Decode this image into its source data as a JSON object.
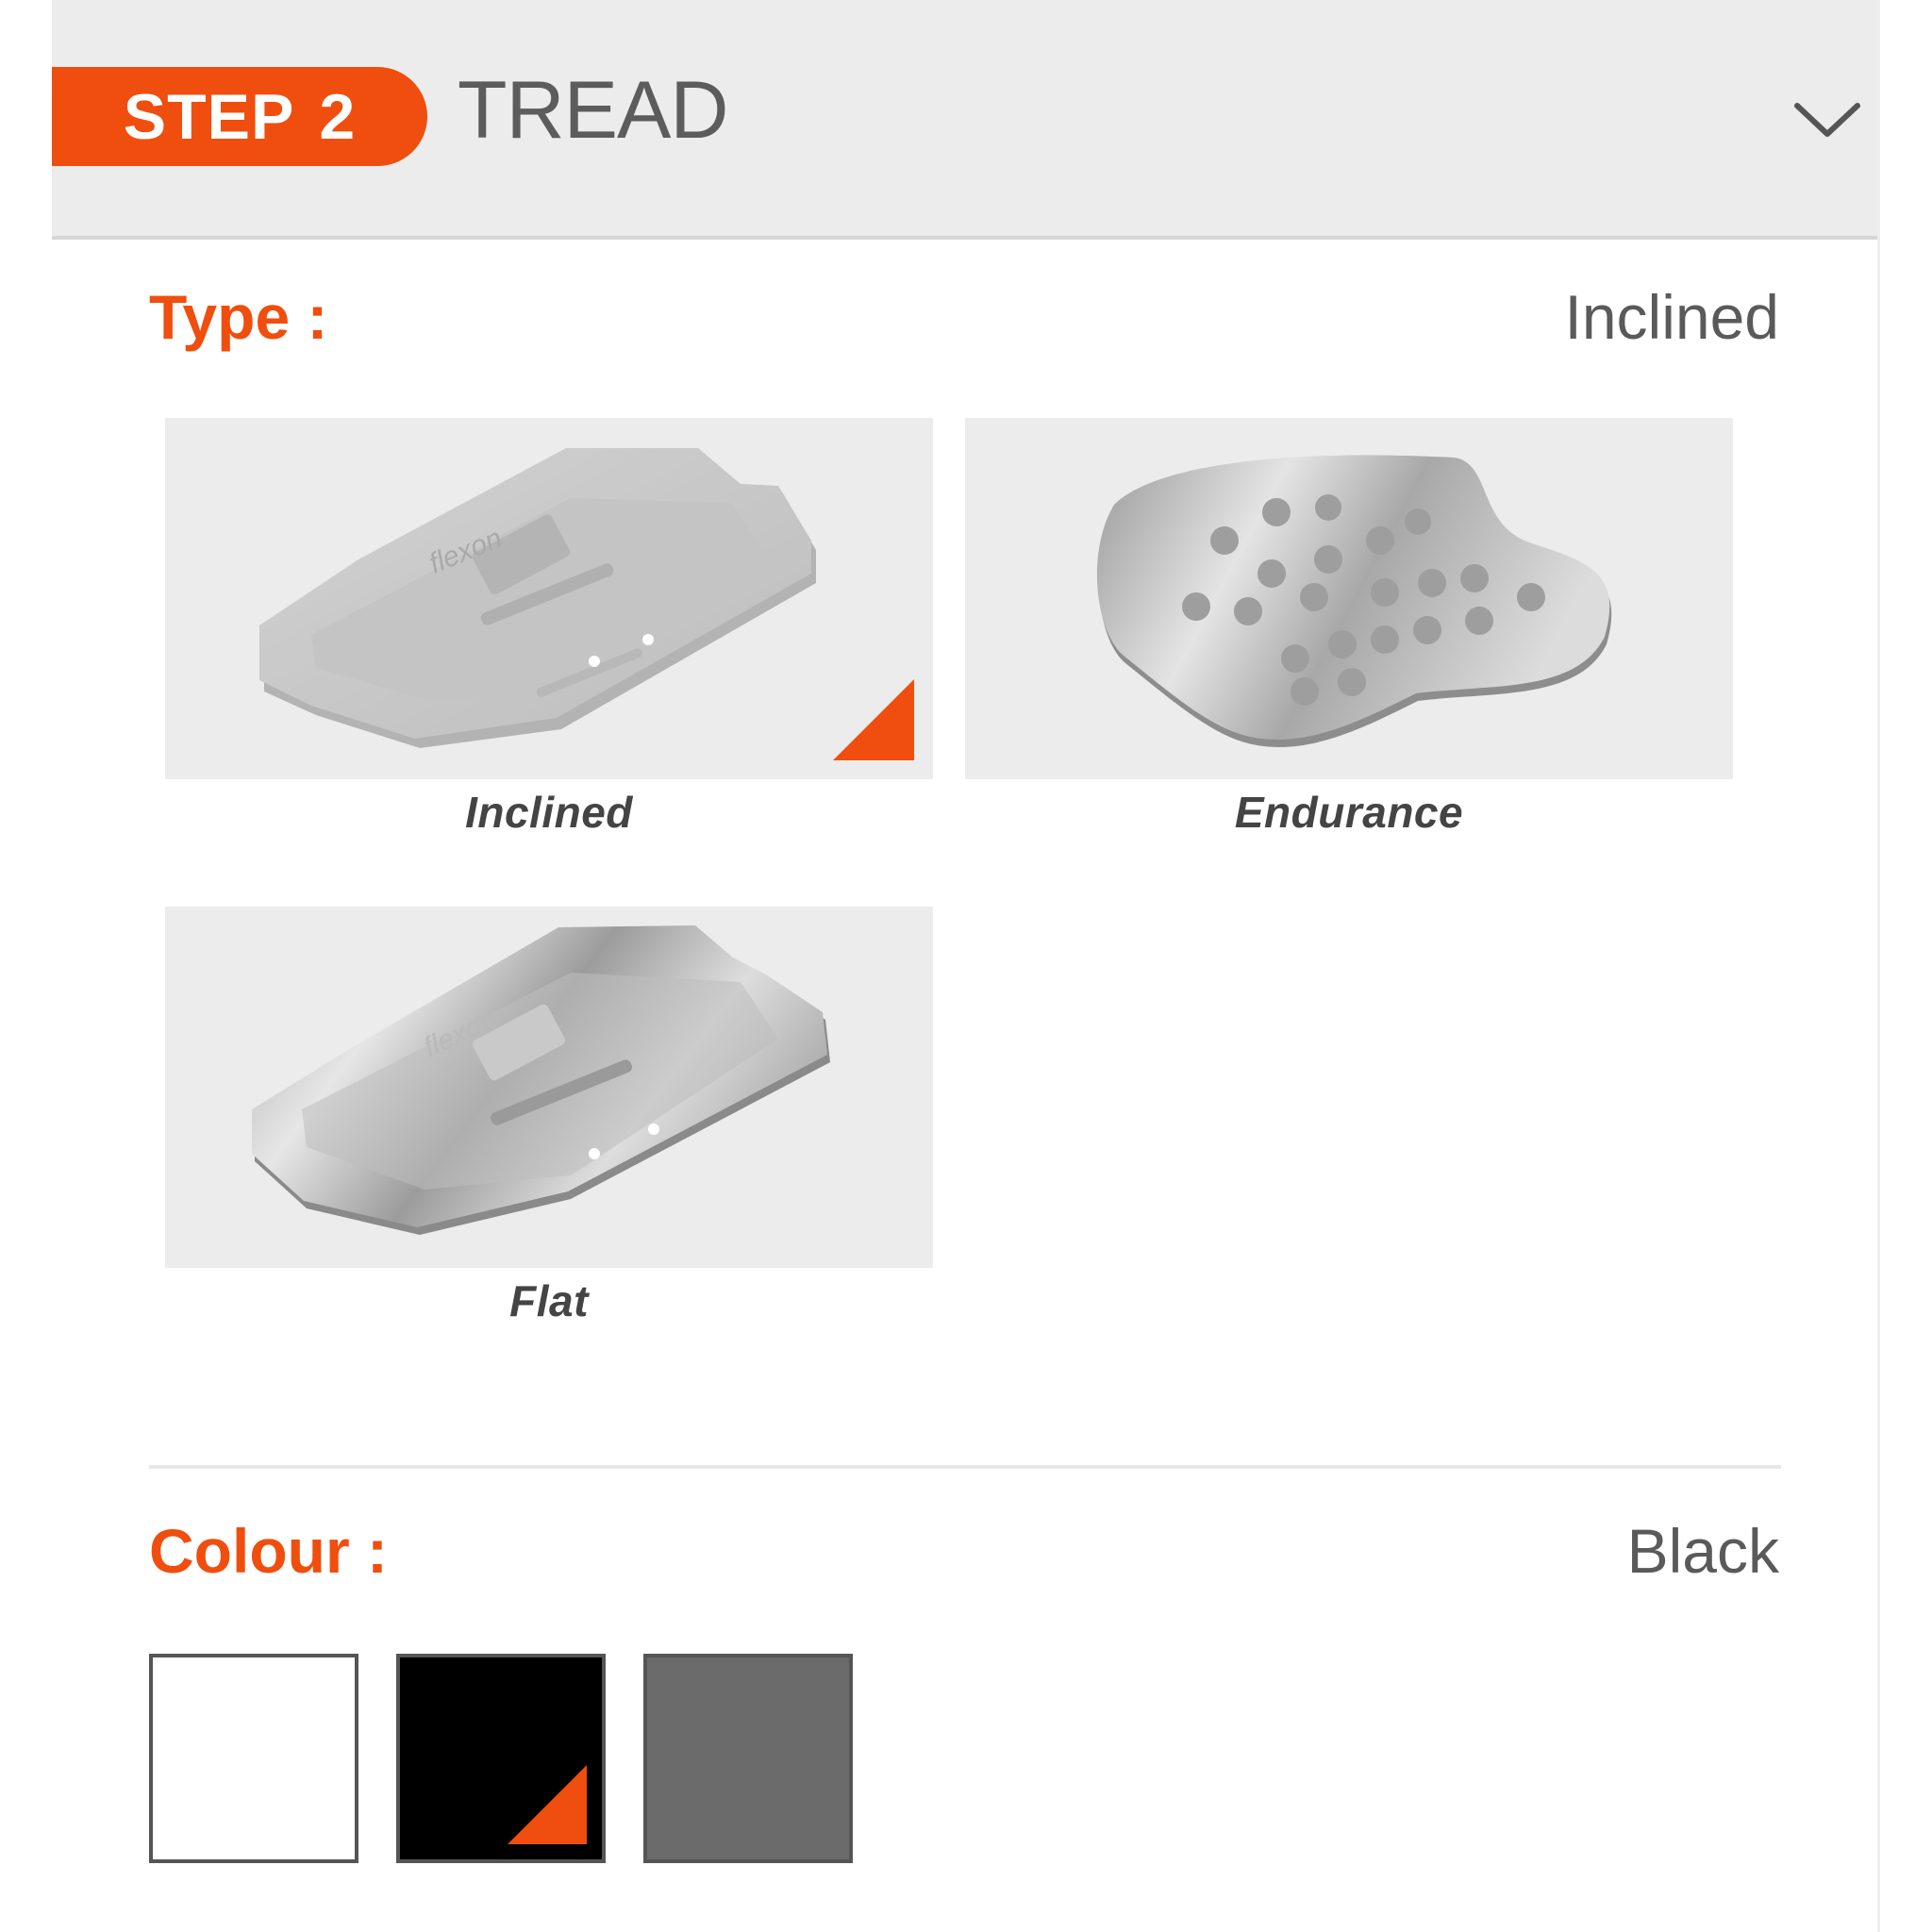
{
  "step": {
    "prefix": "STEP",
    "number": "2",
    "title": "TREAD"
  },
  "type_section": {
    "label": "Type :",
    "selected_value": "Inclined",
    "options": [
      {
        "label": "Inclined",
        "selected": true
      },
      {
        "label": "Endurance",
        "selected": false
      },
      {
        "label": "Flat",
        "selected": false
      }
    ]
  },
  "colour_section": {
    "label": "Colour :",
    "selected_value": "Black",
    "swatches": [
      {
        "name": "white",
        "color": "#ffffff",
        "selected": false
      },
      {
        "name": "black",
        "color": "#000000",
        "selected": true
      },
      {
        "name": "grey",
        "color": "#6b6b6b",
        "selected": false
      }
    ]
  },
  "colors": {
    "accent": "#f04e0e",
    "header_bg": "#ececec",
    "text_muted": "#5a5a5a"
  },
  "icons": {
    "expand": "chevron-down-icon"
  }
}
